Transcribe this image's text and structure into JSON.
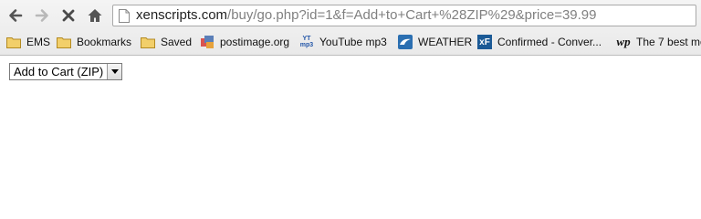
{
  "browser": {
    "url_host": "xenscripts.com",
    "url_path": "/buy/go.php?id=1&f=Add+to+Cart+%28ZIP%29&price=39.99",
    "nav_icons": [
      "back-arrow-icon",
      "forward-arrow-icon",
      "stop-icon",
      "home-icon",
      "page-icon"
    ]
  },
  "bookmarks": [
    {
      "label": "EMS",
      "icon": "folder-icon"
    },
    {
      "label": "Bookmarks",
      "icon": "folder-icon"
    },
    {
      "label": "Saved",
      "icon": "folder-icon"
    },
    {
      "label": "postimage.org",
      "icon": "postimage-icon"
    },
    {
      "label": "YouTube mp3",
      "icon": "youtube-mp3-icon"
    },
    {
      "label": "WEATHER",
      "icon": "weather-icon"
    },
    {
      "label": "Confirmed - Conver...",
      "icon": "xenforo-icon"
    },
    {
      "label": "The 7 best mo",
      "icon": "washington-post-icon"
    }
  ],
  "icon_texts": {
    "youtube_mp3_top": "YT",
    "youtube_mp3_bottom": "mp3",
    "xenforo": "xF",
    "washington_post": "wp"
  },
  "page": {
    "select_value": "Add to Cart (ZIP)"
  },
  "colors": {
    "url_host": "#222222",
    "url_path": "#808080",
    "folder": "#e8c15a",
    "weather": "#2b6fb1",
    "xenforo": "#1b5a96"
  }
}
